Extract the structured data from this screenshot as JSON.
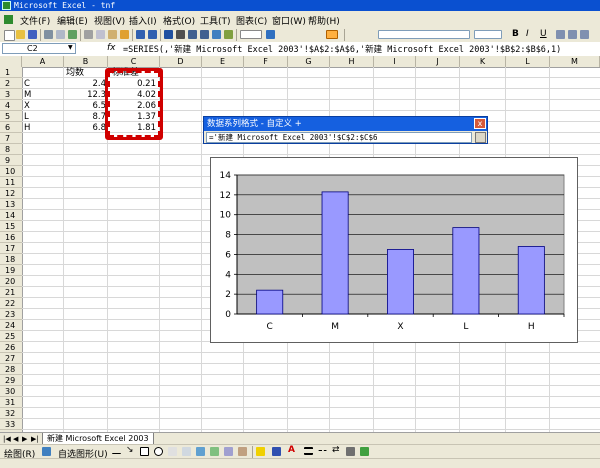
{
  "window": {
    "title": "Microsoft Excel - tnf"
  },
  "menu": {
    "items": [
      "文件(F)",
      "编辑(E)",
      "视图(V)",
      "插入(I)",
      "格式(O)",
      "工具(T)",
      "图表(C)",
      "窗口(W)",
      "帮助(H)"
    ]
  },
  "formula_bar": {
    "name_box": "C2",
    "fx": "fx",
    "formula": "=SERIES(,'新建 Microsoft Excel 2003'!$A$2:$A$6,'新建 Microsoft Excel 2003'!$B$2:$B$6,1)"
  },
  "sheet": {
    "columns": [
      "A",
      "B",
      "C",
      "D",
      "E",
      "F",
      "G",
      "H",
      "I",
      "J",
      "K",
      "L",
      "M"
    ],
    "rows": [
      "1",
      "2",
      "3",
      "4",
      "5",
      "6",
      "7",
      "8",
      "9",
      "10",
      "11",
      "12",
      "13",
      "14",
      "15",
      "16",
      "17",
      "18",
      "19",
      "20",
      "21",
      "22",
      "23",
      "24",
      "25",
      "26",
      "27",
      "28",
      "29",
      "30",
      "31",
      "32",
      "33"
    ],
    "header_b": "均数",
    "header_c": "标准差",
    "labels": [
      "C",
      "M",
      "X",
      "L",
      "H"
    ],
    "means": [
      "2.4",
      "12.3",
      "6.5",
      "8.7",
      "6.8"
    ],
    "sds": [
      "0.21",
      "4.02",
      "2.06",
      "1.37",
      "1.81"
    ]
  },
  "dialog": {
    "title": "数据系列格式 - 自定义 +",
    "close": "x",
    "input": "='新建 Microsoft Excel 2003'!$C$2:$C$6"
  },
  "chart_data": {
    "type": "bar",
    "categories": [
      "C",
      "M",
      "X",
      "L",
      "H"
    ],
    "values": [
      2.4,
      12.3,
      6.5,
      8.7,
      6.8
    ],
    "ylim": [
      0,
      14
    ],
    "yticks": [
      "0",
      "2",
      "4",
      "6",
      "8",
      "10",
      "12",
      "14"
    ],
    "grid": true,
    "colors": {
      "plot_bg": "#c0c0c0",
      "bar": "#9999ff",
      "bar_edge": "#000080"
    }
  },
  "tabs": {
    "sheet_name": "新建 Microsoft Excel 2003"
  },
  "draw_toolbar": {
    "draw_label": "绘图(R)",
    "autoshape_label": "自选图形(U)"
  }
}
